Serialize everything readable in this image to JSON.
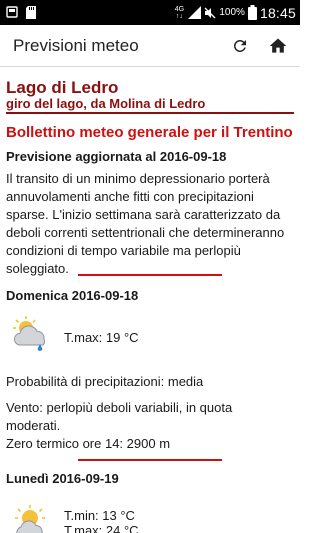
{
  "status_bar": {
    "time": "18:45",
    "battery": "100%",
    "network_top": "4G",
    "network_bottom": "↑↓"
  },
  "app_bar": {
    "title": "Previsioni meteo",
    "actions": [
      "refresh-icon",
      "home-icon"
    ]
  },
  "location": {
    "name": "Lago di Ledro",
    "route": "giro del lago, da Molina di Ledro"
  },
  "bulletin": {
    "title": "Bollettino meteo generale per il Trentino",
    "updated": "Previsione aggiornata al 2016-09-18",
    "text": "Il transito di un minimo depressionario porterà annuvolamenti anche fitti con precipitazioni sparse. L'inizio settimana sarà caratterizzato da deboli correnti settentrionali che determineranno condizioni di tempo variabile ma perlopiù soleggiato."
  },
  "days": [
    {
      "date": "Domenica 2016-09-18",
      "icon": "cloud-sun-rain-icon",
      "tmax": "T.max: 19 °C",
      "precip": "Probabilità di precipitazioni: media",
      "wind": "Vento: perlopiù deboli variabili, in quota moderati.",
      "freezing": "Zero termico ore 14: 2900 m"
    },
    {
      "date": "Lunedì 2016-09-19",
      "icon": "sun-cloud-icon",
      "tmin": "T.min: 13 °C",
      "tmax": "T.max: 24 °C"
    }
  ],
  "colors": {
    "location": "#8a1010",
    "accent": "#d01010"
  }
}
